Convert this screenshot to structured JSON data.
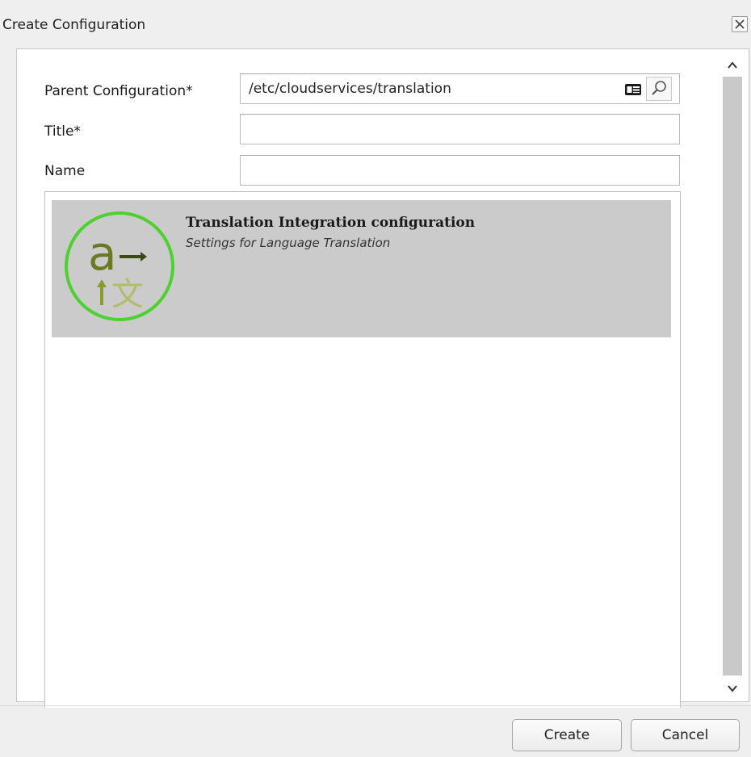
{
  "dialog": {
    "title": "Create Configuration",
    "close_icon": "close-icon"
  },
  "form": {
    "parent_label": "Parent Configuration*",
    "parent_value": "/etc/cloudservices/translation",
    "title_label": "Title*",
    "title_value": "",
    "name_label": "Name",
    "name_value": ""
  },
  "templates": [
    {
      "title": "Translation Integration configuration",
      "description": "Settings for Language Translation",
      "icon": "translation-logo-icon"
    }
  ],
  "buttons": {
    "create": "Create",
    "cancel": "Cancel"
  },
  "colors": {
    "logo_ring": "#4cd12e",
    "logo_glyph": "#6b7a20",
    "selected_item_bg": "#cbcbcb"
  }
}
